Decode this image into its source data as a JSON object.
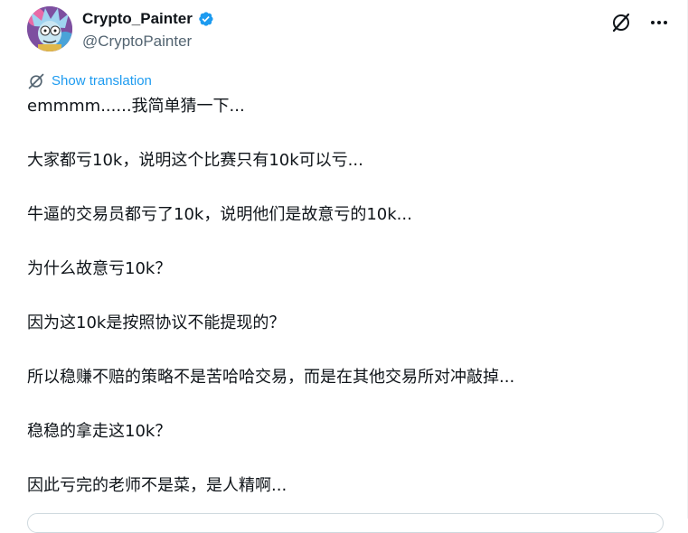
{
  "tweet": {
    "author": {
      "display_name": "Crypto_Painter",
      "handle": "@CryptoPainter",
      "verified": true,
      "avatar_icon": "avatar-image"
    },
    "header_actions": [
      {
        "icon": "grok-icon"
      },
      {
        "icon": "more-icon"
      }
    ],
    "translate_label": "Show translation",
    "paragraphs": [
      "emmmm......我简单猜一下...",
      "大家都亏10k，说明这个比赛只有10k可以亏...",
      "牛逼的交易员都亏了10k，说明他们是故意亏的10k...",
      "为什么故意亏10k？",
      "因为这10k是按照协议不能提现的？",
      "所以稳赚不赔的策略不是苦哈哈交易，而是在其他交易所对冲敲掉...",
      "稳稳的拿走这10k？",
      "因此亏完的老师不是菜，是人精啊..."
    ]
  },
  "colors": {
    "text": "#0f1419",
    "secondary": "#536471",
    "accent": "#1d9bf0",
    "border": "#cfd9de"
  }
}
